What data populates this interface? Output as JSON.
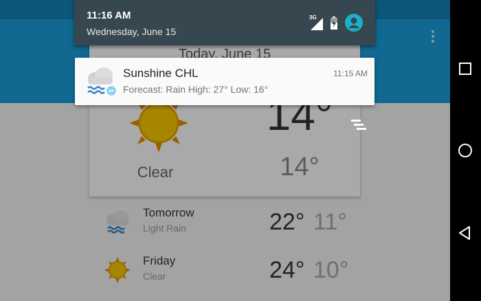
{
  "status_bar": {
    "time": "11:16 AM",
    "date": "Wednesday, June 15",
    "network_label": "3G",
    "icons": [
      "signal-icon",
      "battery-icon",
      "user-avatar-icon"
    ]
  },
  "notification": {
    "app_name": "Sunshine CHL",
    "text": "Forecast: Rain High: 27° Low: 16°",
    "time": "11:15 AM",
    "icon": "rain-cloud-icon"
  },
  "today": {
    "date": "Today, June 15",
    "high": "14°",
    "low": "14°",
    "description": "Clear",
    "icon": "sun-icon"
  },
  "forecast": [
    {
      "day": "Tomorrow",
      "description": "Light Rain",
      "high": "22°",
      "low": "11°",
      "icon": "rain-cloud-icon"
    },
    {
      "day": "Friday",
      "description": "Clear",
      "high": "24°",
      "low": "10°",
      "icon": "sun-icon"
    }
  ],
  "navigation": {
    "buttons": [
      "recents-button",
      "home-button",
      "back-button"
    ]
  },
  "colors": {
    "app_bar": "#1a9bd6",
    "notification_shade": "#37474f",
    "avatar": "#1bb0c9",
    "sun": "#f5c400",
    "rain": "#4a90c8"
  }
}
